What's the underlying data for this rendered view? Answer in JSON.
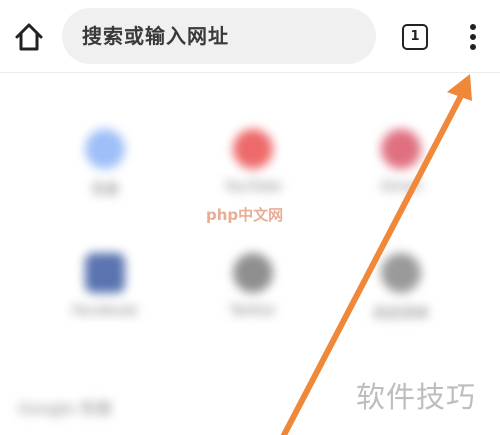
{
  "toolbar": {
    "home_icon": "home-icon",
    "search_placeholder": "搜索或输入网址",
    "tab_count": "1",
    "menu_icon": "three-dot-menu-icon"
  },
  "shortcuts": [
    {
      "label": "百度",
      "color": "#9ebff7"
    },
    {
      "label": "YouTube",
      "color": "#ee6a6a"
    },
    {
      "label": "Gmail",
      "color": "#e07080"
    },
    {
      "label": "Facebook",
      "color": "#5a74b0"
    },
    {
      "label": "Twitter",
      "color": "#8f8f8f"
    },
    {
      "label": "阅读清单",
      "color": "#9a9a9a"
    }
  ],
  "section": {
    "title": "Google 热搜"
  },
  "watermarks": {
    "center": "php中文网",
    "corner": "软件技巧"
  },
  "annotation": {
    "arrow_color": "#f0883a"
  }
}
